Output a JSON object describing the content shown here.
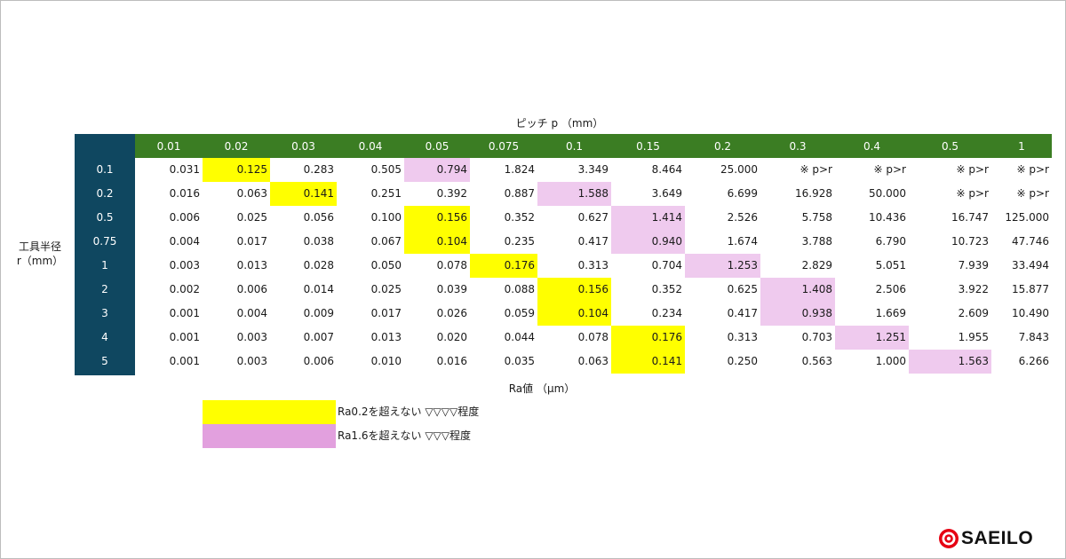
{
  "x_axis_title": "ピッチ p （mm）",
  "y_axis_title_lines": [
    "工具半径",
    "r（mm）"
  ],
  "value_label": "Ra値 （μm）",
  "columns": [
    "0.01",
    "0.02",
    "0.03",
    "0.04",
    "0.05",
    "0.075",
    "0.1",
    "0.15",
    "0.2",
    "0.3",
    "0.4",
    "0.5",
    "1"
  ],
  "rows": [
    {
      "radius": "0.1",
      "values": [
        "0.031",
        "0.125",
        "0.283",
        "0.505",
        "0.794",
        "1.824",
        "3.349",
        "8.464",
        "25.000",
        "※ p>r",
        "※ p>r",
        "※ p>r",
        "※ p>r"
      ],
      "highlight": {
        "ra02": 1,
        "ra16": 4
      }
    },
    {
      "radius": "0.2",
      "values": [
        "0.016",
        "0.063",
        "0.141",
        "0.251",
        "0.392",
        "0.887",
        "1.588",
        "3.649",
        "6.699",
        "16.928",
        "50.000",
        "※ p>r",
        "※ p>r"
      ],
      "highlight": {
        "ra02": 2,
        "ra16": 6
      }
    },
    {
      "radius": "0.5",
      "values": [
        "0.006",
        "0.025",
        "0.056",
        "0.100",
        "0.156",
        "0.352",
        "0.627",
        "1.414",
        "2.526",
        "5.758",
        "10.436",
        "16.747",
        "125.000"
      ],
      "highlight": {
        "ra02": 4,
        "ra16": 7
      }
    },
    {
      "radius": "0.75",
      "values": [
        "0.004",
        "0.017",
        "0.038",
        "0.067",
        "0.104",
        "0.235",
        "0.417",
        "0.940",
        "1.674",
        "3.788",
        "6.790",
        "10.723",
        "47.746"
      ],
      "highlight": {
        "ra02": 4,
        "ra16": 7
      }
    },
    {
      "radius": "1",
      "values": [
        "0.003",
        "0.013",
        "0.028",
        "0.050",
        "0.078",
        "0.176",
        "0.313",
        "0.704",
        "1.253",
        "2.829",
        "5.051",
        "7.939",
        "33.494"
      ],
      "highlight": {
        "ra02": 5,
        "ra16": 8
      }
    },
    {
      "radius": "2",
      "values": [
        "0.002",
        "0.006",
        "0.014",
        "0.025",
        "0.039",
        "0.088",
        "0.156",
        "0.352",
        "0.625",
        "1.408",
        "2.506",
        "3.922",
        "15.877"
      ],
      "highlight": {
        "ra02": 6,
        "ra16": 9
      }
    },
    {
      "radius": "3",
      "values": [
        "0.001",
        "0.004",
        "0.009",
        "0.017",
        "0.026",
        "0.059",
        "0.104",
        "0.234",
        "0.417",
        "0.938",
        "1.669",
        "2.609",
        "10.490"
      ],
      "highlight": {
        "ra02": 6,
        "ra16": 9
      }
    },
    {
      "radius": "4",
      "values": [
        "0.001",
        "0.003",
        "0.007",
        "0.013",
        "0.020",
        "0.044",
        "0.078",
        "0.176",
        "0.313",
        "0.703",
        "1.251",
        "1.955",
        "7.843"
      ],
      "highlight": {
        "ra02": 7,
        "ra16": 10
      }
    },
    {
      "radius": "5",
      "values": [
        "0.001",
        "0.003",
        "0.006",
        "0.010",
        "0.016",
        "0.035",
        "0.063",
        "0.141",
        "0.250",
        "0.563",
        "1.000",
        "1.563",
        "6.266"
      ],
      "highlight": {
        "ra02": 7,
        "ra16": 11
      }
    }
  ],
  "legend": [
    {
      "text": "Ra0.2を超えない ▽▽▽▽程度",
      "color": "#ffff00"
    },
    {
      "text": "Ra1.6を超えない ▽▽▽程度",
      "color": "#e2a0de"
    }
  ],
  "colors": {
    "row_header_bg": "#0f4760",
    "column_header_bg": "#3b7d23",
    "highlight_ra02": "#ffff00",
    "highlight_ra16": "#efcaee",
    "logo_red": "#e60012"
  },
  "logo": {
    "text": "SAEILO",
    "icon": "saeilo-logo-icon"
  }
}
